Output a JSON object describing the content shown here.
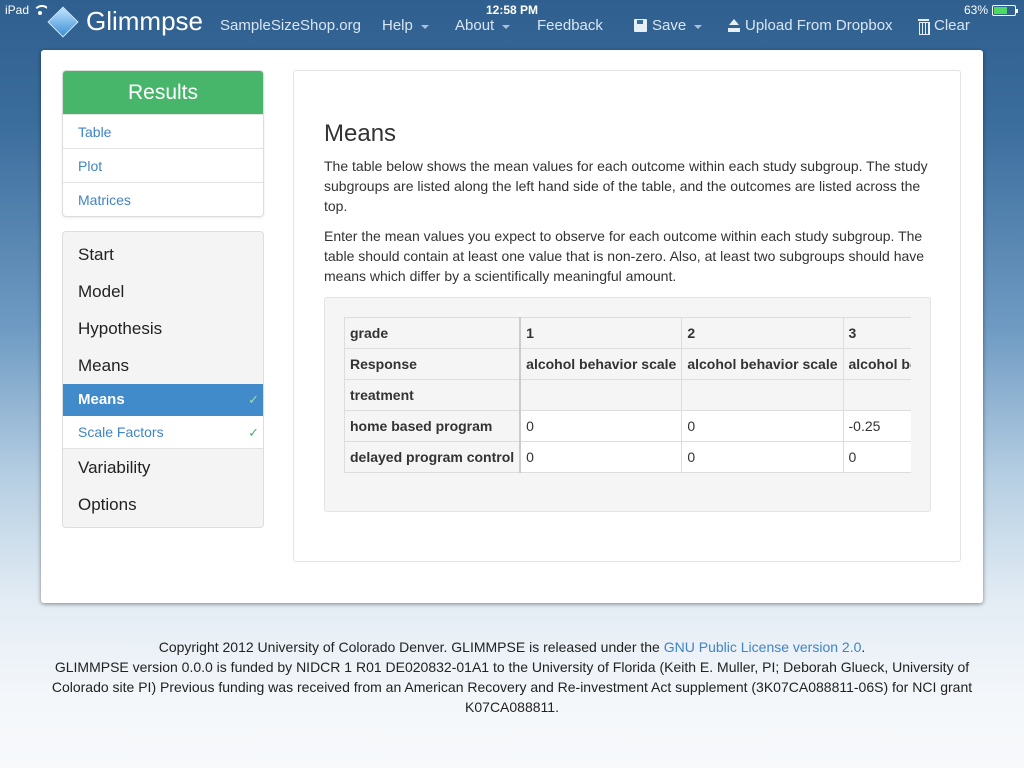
{
  "status_bar": {
    "device": "iPad",
    "time": "12:58 PM",
    "battery": "63%",
    "battery_level": 0.63
  },
  "nav": {
    "brand": "Glimmpse",
    "items": [
      {
        "label": "SampleSizeShop.org"
      },
      {
        "label": "Help"
      },
      {
        "label": "About"
      },
      {
        "label": "Feedback"
      },
      {
        "label": "Save"
      },
      {
        "label": "Upload From Dropbox"
      },
      {
        "label": "Clear"
      }
    ]
  },
  "results": {
    "title": "Results",
    "links": [
      "Table",
      "Plot",
      "Matrices"
    ]
  },
  "steps": {
    "items": [
      "Start",
      "Model",
      "Hypothesis",
      "Means"
    ],
    "active": "Means",
    "sub": "Scale Factors",
    "after": [
      "Variability",
      "Options"
    ],
    "check": "✓"
  },
  "content": {
    "title": "Means",
    "paragraph1": "The table below shows the mean values for each outcome within each study subgroup. The study subgroups are listed along the left hand side of the table, and the outcomes are listed across the top.",
    "paragraph2": "Enter the mean values you expect to observe for each outcome within each study subgroup. The table should contain at least one value that is non-zero. Also, at least two subgroups should have means which differ by a scientifically meaningful amount."
  },
  "table": {
    "row_headers": [
      "grade",
      "Response",
      "treatment",
      "home based program",
      "delayed program control"
    ],
    "grade": [
      "1",
      "2",
      "3"
    ],
    "response": [
      "alcohol behavior scale",
      "alcohol behavior scale",
      "alcohol behavior scale"
    ],
    "treatment": [
      "",
      "",
      ""
    ],
    "home_based_program": [
      "0",
      "0",
      "-0.25"
    ],
    "delayed_program_control": [
      "0",
      "0",
      "0"
    ]
  },
  "footer": {
    "line1_pre": "Copyright 2012 University of Colorado Denver. GLIMMPSE is released under the ",
    "license_link": "GNU Public License version 2.0",
    "line1_post": ".",
    "line2": "GLIMMPSE version 0.0.0 is funded by NIDCR 1 R01 DE020832-01A1 to the University of Florida (Keith E. Muller, PI; Deborah Glueck, University of Colorado site PI) Previous funding was received from an American Recovery and Re-investment Act supplement (3K07CA088811-06S) for NCI grant K07CA088811."
  }
}
